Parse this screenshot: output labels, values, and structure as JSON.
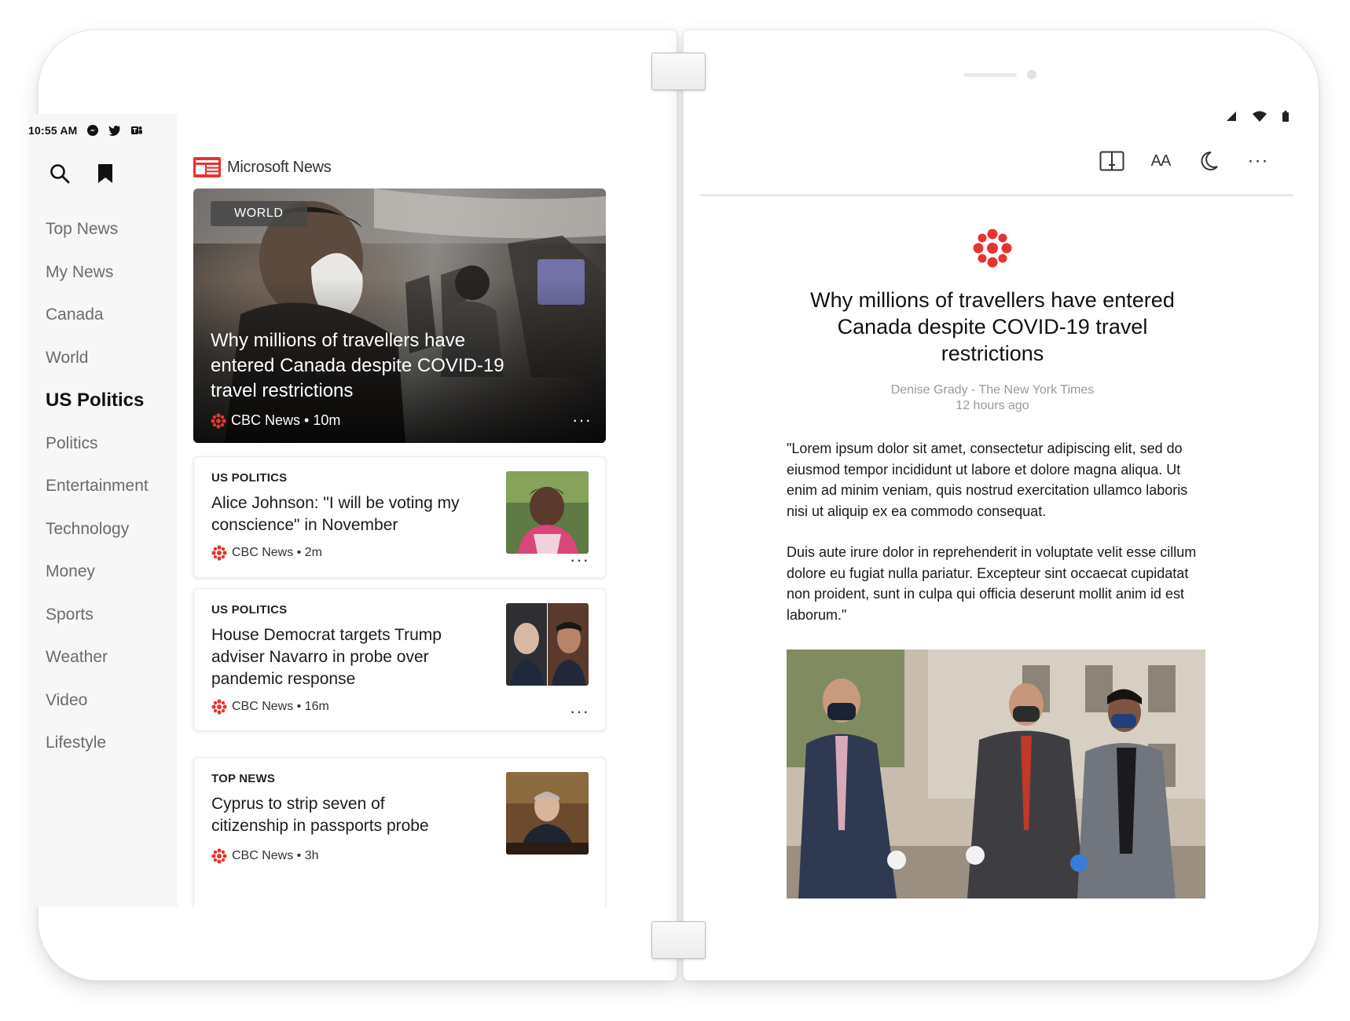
{
  "status_bar": {
    "time": "10:55 AM",
    "icons": [
      "messenger-icon",
      "twitter-icon",
      "teams-icon"
    ]
  },
  "sidebar": {
    "tools": [
      "search-icon",
      "bookmark-icon"
    ],
    "items": [
      {
        "label": "Top News"
      },
      {
        "label": "My News"
      },
      {
        "label": "Canada"
      },
      {
        "label": "World"
      },
      {
        "label": "US Politics",
        "active": true
      },
      {
        "label": "Politics"
      },
      {
        "label": "Entertainment"
      },
      {
        "label": "Technology"
      },
      {
        "label": "Money"
      },
      {
        "label": "Sports"
      },
      {
        "label": "Weather"
      },
      {
        "label": "Video"
      },
      {
        "label": "Lifestyle"
      }
    ]
  },
  "brand": {
    "name": "Microsoft News",
    "logo_color": "#e8332f"
  },
  "hero": {
    "tag": "WORLD",
    "title": "Why millions of travellers have entered Canada despite COVID-19 travel restrictions",
    "source": "CBC News",
    "age": "10m",
    "meta": "CBC News • 10m",
    "more": "···"
  },
  "cards": [
    {
      "category": "US POLITICS",
      "title": "Alice Johnson: \"I will be voting my conscience\" in November",
      "meta": "CBC News • 2m",
      "more": "···"
    },
    {
      "category": "US POLITICS",
      "title": "House Democrat targets Trump adviser Navarro in probe over pandemic response",
      "meta": "CBC News • 16m",
      "more": "···"
    },
    {
      "category": "TOP NEWS",
      "title": "Cyprus to strip seven of citizenship in passports probe",
      "meta": "CBC News • 3h",
      "more": "···"
    }
  ],
  "reader": {
    "toolbar": [
      "dual-view-icon",
      "text-size-icon",
      "dark-mode-icon",
      "more-icon"
    ],
    "text_size_label": "AA",
    "more_label": "···",
    "article": {
      "source_logo": "cbc-logo-icon",
      "title": "Why millions of travellers have entered Canada despite COVID-19 travel restrictions",
      "byline": "Denise Grady - The New York Times",
      "time": "12 hours ago",
      "paragraphs": [
        "\"Lorem ipsum dolor sit amet, consectetur adipiscing elit, sed do eiusmod tempor incididunt ut labore et dolore magna aliqua. Ut enim ad minim veniam, quis nostrud exercitation ullamco laboris nisi ut aliquip ex ea commodo consequat.",
        "Duis aute irure dolor in reprehenderit in voluptate velit esse cillum dolore eu fugiat nulla pariatur. Excepteur sint occaecat cupidatat non proident, sunt in culpa qui officia deserunt mollit anim id est laborum.\""
      ]
    }
  },
  "colors": {
    "accent_red": "#e8332f",
    "active_text": "#111111",
    "muted_text": "#6b6b6b",
    "byline": "#9a9a9a"
  }
}
